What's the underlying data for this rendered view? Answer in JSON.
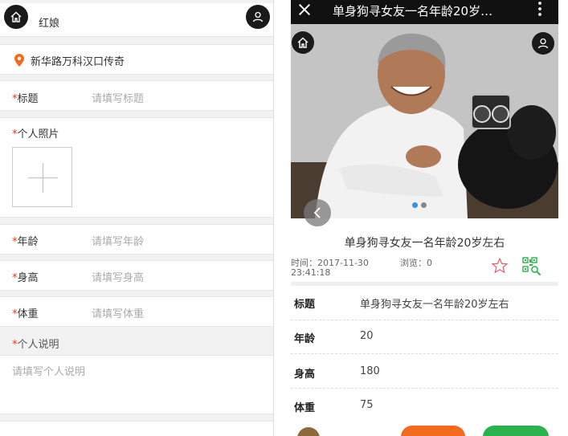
{
  "form": {
    "header_title": "红娘",
    "location": "新华路万科汉口传奇",
    "required_mark": "*",
    "title_label": "标题",
    "title_placeholder": "请填写标题",
    "photo_label": "个人照片",
    "age_label": "年龄",
    "age_placeholder": "请填写年龄",
    "height_label": "身高",
    "height_placeholder": "请填写身高",
    "weight_label": "体重",
    "weight_placeholder": "请填写体重",
    "desc_label": "个人说明",
    "desc_placeholder": "请填写个人说明"
  },
  "detail": {
    "nav_title": "单身狗寻女友一名年龄20岁…",
    "post_title": "单身狗寻女友一名年龄20岁左右",
    "time_text": "时间：2017-11-30",
    "time_text_2": "23:41:18",
    "views_text": "浏览：0",
    "rows": [
      {
        "key": "标题",
        "value": "单身狗寻女友一名年龄20岁左右"
      },
      {
        "key": "年龄",
        "value": "20"
      },
      {
        "key": "身高",
        "value": "180"
      },
      {
        "key": "体重",
        "value": "75"
      }
    ]
  },
  "colors": {
    "accent_orange": "#f26a1b",
    "accent_green": "#2bb24c",
    "location_pin": "#f26a1b",
    "required": "#e03c1e",
    "dot_active": "#3a8fe0"
  },
  "icons": [
    "home-icon",
    "user-icon",
    "location-pin-icon",
    "plus-icon",
    "close-icon",
    "more-icon",
    "chevron-left-icon",
    "star-icon",
    "qr-code-icon"
  ]
}
